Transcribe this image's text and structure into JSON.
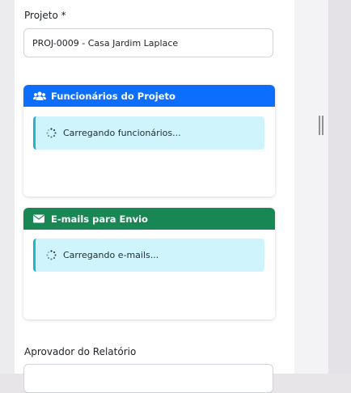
{
  "form": {
    "project_label": "Projeto *",
    "project_value": "PROJ-0009 - Casa Jardim Laplace",
    "approver_label": "Aprovador do Relatório"
  },
  "employees_card": {
    "title": "Funcionários do Projeto",
    "icon": "users-icon",
    "header_color": "#0d6efd",
    "loading_text": "Carregando funcionários..."
  },
  "emails_card": {
    "title": "E-mails para Envio",
    "icon": "envelope-icon",
    "header_color": "#198754",
    "loading_text": "Carregando e-mails..."
  }
}
